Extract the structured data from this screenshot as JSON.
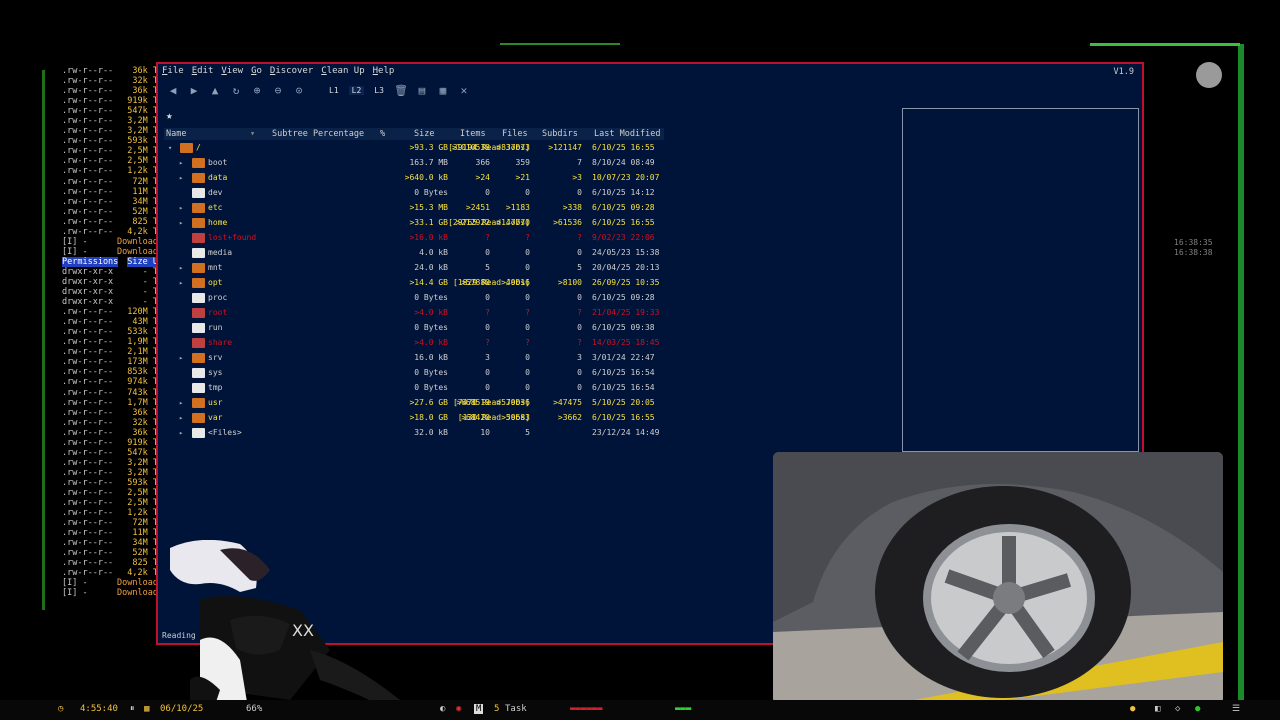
{
  "terminal": {
    "rows": [
      {
        "perm": ".rw-r--r--",
        "size": "36k T"
      },
      {
        "perm": ".rw-r--r--",
        "size": "32k T"
      },
      {
        "perm": ".rw-r--r--",
        "size": "36k T"
      },
      {
        "perm": ".rw-r--r--",
        "size": "919k T"
      },
      {
        "perm": ".rw-r--r--",
        "size": "547k T"
      },
      {
        "perm": ".rw-r--r--",
        "size": "3,2M T"
      },
      {
        "perm": ".rw-r--r--",
        "size": "3,2M T"
      },
      {
        "perm": ".rw-r--r--",
        "size": "593k T"
      },
      {
        "perm": ".rw-r--r--",
        "size": "2,5M T"
      },
      {
        "perm": ".rw-r--r--",
        "size": "2,5M T"
      },
      {
        "perm": ".rw-r--r--",
        "size": "1,2k T"
      },
      {
        "perm": ".rw-r--r--",
        "size": "72M T"
      },
      {
        "perm": ".rw-r--r--",
        "size": "11M T"
      },
      {
        "perm": ".rw-r--r--",
        "size": "34M T"
      },
      {
        "perm": ".rw-r--r--",
        "size": "52M T"
      },
      {
        "perm": ".rw-r--r--",
        "size": "825 T"
      },
      {
        "perm": ".rw-r--r--",
        "size": "4,2k T"
      },
      {
        "perm": "[I] - ",
        "size": "Download"
      },
      {
        "perm": "[I] - ",
        "size": "Download"
      },
      {
        "perm": "Permissions",
        "size": "Size U"
      },
      {
        "perm": "drwxr-xr-x",
        "size": "- T"
      },
      {
        "perm": "drwxr-xr-x",
        "size": "- T"
      },
      {
        "perm": "drwxr-xr-x",
        "size": "- T"
      },
      {
        "perm": "drwxr-xr-x",
        "size": "- T"
      },
      {
        "perm": ".rw-r--r--",
        "size": "120M T"
      },
      {
        "perm": ".rw-r--r--",
        "size": "43M T"
      },
      {
        "perm": ".rw-r--r--",
        "size": "533k T"
      },
      {
        "perm": ".rw-r--r--",
        "size": "1,9M T"
      },
      {
        "perm": ".rw-r--r--",
        "size": "2,1M T"
      },
      {
        "perm": ".rw-r--r--",
        "size": "173M T"
      },
      {
        "perm": ".rw-r--r--",
        "size": "853k T"
      },
      {
        "perm": ".rw-r--r--",
        "size": "974k T"
      },
      {
        "perm": ".rw-r--r--",
        "size": "743k T"
      },
      {
        "perm": ".rw-r--r--",
        "size": "1,7M T"
      },
      {
        "perm": ".rw-r--r--",
        "size": "36k T"
      },
      {
        "perm": ".rw-r--r--",
        "size": "32k T"
      },
      {
        "perm": ".rw-r--r--",
        "size": "36k T"
      },
      {
        "perm": ".rw-r--r--",
        "size": "919k T"
      },
      {
        "perm": ".rw-r--r--",
        "size": "547k T"
      },
      {
        "perm": ".rw-r--r--",
        "size": "3,2M T"
      },
      {
        "perm": ".rw-r--r--",
        "size": "3,2M T"
      },
      {
        "perm": ".rw-r--r--",
        "size": "593k T"
      },
      {
        "perm": ".rw-r--r--",
        "size": "2,5M T"
      },
      {
        "perm": ".rw-r--r--",
        "size": "2,5M T"
      },
      {
        "perm": ".rw-r--r--",
        "size": "1,2k T"
      },
      {
        "perm": ".rw-r--r--",
        "size": "72M T"
      },
      {
        "perm": ".rw-r--r--",
        "size": "11M T"
      },
      {
        "perm": ".rw-r--r--",
        "size": "34M T"
      },
      {
        "perm": ".rw-r--r--",
        "size": "52M T"
      },
      {
        "perm": ".rw-r--r--",
        "size": "825 T"
      },
      {
        "perm": ".rw-r--r--",
        "size": "4,2k T"
      },
      {
        "perm": "[I] - ",
        "size": "Download"
      },
      {
        "perm": "[I] - ",
        "size": "Download"
      }
    ]
  },
  "window": {
    "version": "V1.9",
    "menu": [
      {
        "u": "F",
        "rest": "ile"
      },
      {
        "u": "E",
        "rest": "dit"
      },
      {
        "u": "V",
        "rest": "iew"
      },
      {
        "u": "G",
        "rest": "o"
      },
      {
        "u": "D",
        "rest": "iscover"
      },
      {
        "u": "C",
        "rest": "lean Up"
      },
      {
        "u": "H",
        "rest": "elp"
      }
    ],
    "levels": [
      "L1",
      "L2",
      "L3"
    ],
    "columns": {
      "name": "Name",
      "subtree": "Subtree Percentage",
      "pct": "%",
      "size": "Size",
      "items": "Items",
      "files": "Files",
      "subdirs": "Subdirs",
      "modified": "Last Modified"
    },
    "rows": [
      {
        "name": "/",
        "jobs": "[39194 Read Jobs]",
        "size": ">93.3 GB",
        "items": ">1010538",
        "files": ">837073",
        "subdirs": ">121147",
        "modified": "6/10/25 16:55",
        "style": "root"
      },
      {
        "name": "boot",
        "jobs": "",
        "size": "163.7 MB",
        "items": "366",
        "files": "359",
        "subdirs": "7",
        "modified": "8/10/24 08:49",
        "style": "dir"
      },
      {
        "name": "data",
        "jobs": "",
        "size": ">640.0 kB",
        "items": ">24",
        "files": ">21",
        "subdirs": ">3",
        "modified": "10/07/23 20:07",
        "style": "yel"
      },
      {
        "name": "dev",
        "jobs": "",
        "size": "0 Bytes",
        "items": "0",
        "files": "0",
        "subdirs": "0",
        "modified": "6/10/25 14:12",
        "style": "plain"
      },
      {
        "name": "etc",
        "jobs": "",
        "size": ">15.3 MB",
        "items": ">2451",
        "files": ">1183",
        "subdirs": ">338",
        "modified": "6/10/25 09:28",
        "style": "yel"
      },
      {
        "name": "home",
        "jobs": "[29765 Read Jobs]",
        "size": ">33.1 GB",
        "items": ">212922",
        "files": ">147770",
        "subdirs": ">61536",
        "modified": "6/10/25 16:55",
        "style": "yel"
      },
      {
        "name": "lost+found",
        "jobs": "",
        "size": ">16.0 kB",
        "items": "?",
        "files": "?",
        "subdirs": "?",
        "modified": "9/02/23 22:06",
        "style": "red"
      },
      {
        "name": "media",
        "jobs": "",
        "size": "4.0 kB",
        "items": "0",
        "files": "0",
        "subdirs": "0",
        "modified": "24/05/23 15:38",
        "style": "plain"
      },
      {
        "name": "mnt",
        "jobs": "",
        "size": "24.0 kB",
        "items": "5",
        "files": "0",
        "subdirs": "5",
        "modified": "20/04/25 20:13",
        "style": "dir"
      },
      {
        "name": "opt",
        "jobs": "[1829 Read Jobs]",
        "size": ">14.4 GB",
        "items": ">57880",
        "files": ">49016",
        "subdirs": ">8100",
        "modified": "26/09/25 10:35",
        "style": "yel"
      },
      {
        "name": "proc",
        "jobs": "",
        "size": "0 Bytes",
        "items": "0",
        "files": "0",
        "subdirs": "0",
        "modified": "6/10/25 09:28",
        "style": "plain"
      },
      {
        "name": "root",
        "jobs": "",
        "size": ">4.0 kB",
        "items": "?",
        "files": "?",
        "subdirs": "?",
        "modified": "21/04/25 19:33",
        "style": "red"
      },
      {
        "name": "run",
        "jobs": "",
        "size": "0 Bytes",
        "items": "0",
        "files": "0",
        "subdirs": "0",
        "modified": "6/10/25 09:38",
        "style": "plain"
      },
      {
        "name": "share",
        "jobs": "",
        "size": ">4.0 kB",
        "items": "?",
        "files": "?",
        "subdirs": "?",
        "modified": "14/03/25 18:45",
        "style": "red"
      },
      {
        "name": "srv",
        "jobs": "",
        "size": "16.0 kB",
        "items": "3",
        "files": "0",
        "subdirs": "3",
        "modified": "3/01/24 22:47",
        "style": "dir"
      },
      {
        "name": "sys",
        "jobs": "",
        "size": "0 Bytes",
        "items": "0",
        "files": "0",
        "subdirs": "0",
        "modified": "6/10/25 16:54",
        "style": "plain"
      },
      {
        "name": "tmp",
        "jobs": "",
        "size": "0 Bytes",
        "items": "0",
        "files": "0",
        "subdirs": "0",
        "modified": "6/10/25 16:54",
        "style": "plain"
      },
      {
        "name": "usr",
        "jobs": "[7470 Read Jobs]",
        "size": ">27.6 GB",
        "items": ">668519",
        "files": ">579036",
        "subdirs": ">47475",
        "modified": "5/10/25 20:05",
        "style": "yel"
      },
      {
        "name": "var",
        "jobs": "[130 Read Jobs]",
        "size": ">18.0 GB",
        "items": ">68420",
        "files": ">59683",
        "subdirs": ">3662",
        "modified": "6/10/25 16:55",
        "style": "yel"
      },
      {
        "name": "<Files>",
        "jobs": "",
        "size": "32.0 kB",
        "items": "10",
        "files": "5",
        "subdirs": "",
        "modified": "23/12/24 14:49",
        "style": "files"
      }
    ],
    "status": "Reading ..."
  },
  "side_clock": [
    "16:38:35",
    "16:38:38"
  ],
  "taskbar": {
    "time": "4:55:40",
    "date": "06/10/25",
    "percent": "66%",
    "workspace": "5",
    "task": "Task"
  }
}
